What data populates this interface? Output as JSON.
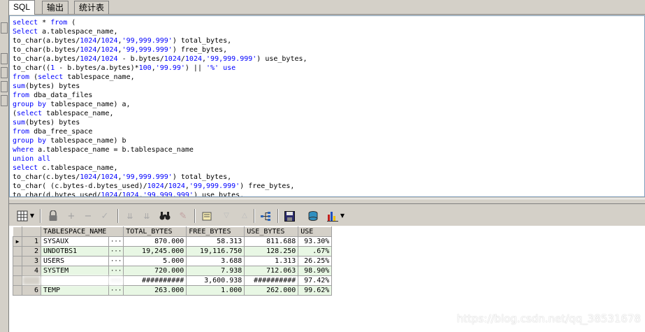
{
  "tabs": [
    {
      "label": "SQL",
      "active": true
    },
    {
      "label": "输出",
      "active": false
    },
    {
      "label": "统计表",
      "active": false
    }
  ],
  "editor": {
    "lines": [
      [
        [
          "kw",
          "select"
        ],
        [
          "plain",
          " * "
        ],
        [
          "kw",
          "from"
        ],
        [
          "plain",
          " ("
        ]
      ],
      [
        [
          "kw",
          "Select"
        ],
        [
          "plain",
          " a.tablespace_name,"
        ]
      ],
      [
        [
          "plain",
          "to_char(a.bytes/"
        ],
        [
          "num",
          "1024"
        ],
        [
          "plain",
          "/"
        ],
        [
          "num",
          "1024"
        ],
        [
          "plain",
          ","
        ],
        [
          "str",
          "'99,999.999'"
        ],
        [
          "plain",
          ") total_bytes,"
        ]
      ],
      [
        [
          "plain",
          "to_char(b.bytes/"
        ],
        [
          "num",
          "1024"
        ],
        [
          "plain",
          "/"
        ],
        [
          "num",
          "1024"
        ],
        [
          "plain",
          ","
        ],
        [
          "str",
          "'99,999.999'"
        ],
        [
          "plain",
          ") free_bytes,"
        ]
      ],
      [
        [
          "plain",
          "to_char(a.bytes/"
        ],
        [
          "num",
          "1024"
        ],
        [
          "plain",
          "/"
        ],
        [
          "num",
          "1024"
        ],
        [
          "plain",
          " - b.bytes/"
        ],
        [
          "num",
          "1024"
        ],
        [
          "plain",
          "/"
        ],
        [
          "num",
          "1024"
        ],
        [
          "plain",
          ","
        ],
        [
          "str",
          "'99,999.999'"
        ],
        [
          "plain",
          ") use_bytes,"
        ]
      ],
      [
        [
          "plain",
          "to_char(("
        ],
        [
          "num",
          "1"
        ],
        [
          "plain",
          " - b.bytes/a.bytes)*"
        ],
        [
          "num",
          "100"
        ],
        [
          "plain",
          ","
        ],
        [
          "str",
          "'99.99'"
        ],
        [
          "plain",
          ") || "
        ],
        [
          "str",
          "'%'"
        ],
        [
          "plain",
          " "
        ],
        [
          "kw",
          "use"
        ]
      ],
      [
        [
          "kw",
          "from"
        ],
        [
          "plain",
          " ("
        ],
        [
          "kw",
          "select"
        ],
        [
          "plain",
          " tablespace_name,"
        ]
      ],
      [
        [
          "kw",
          "sum"
        ],
        [
          "plain",
          "(bytes) bytes"
        ]
      ],
      [
        [
          "kw",
          "from"
        ],
        [
          "plain",
          " dba_data_files"
        ]
      ],
      [
        [
          "kw",
          "group by"
        ],
        [
          "plain",
          " tablespace_name) a,"
        ]
      ],
      [
        [
          "plain",
          "("
        ],
        [
          "kw",
          "select"
        ],
        [
          "plain",
          " tablespace_name,"
        ]
      ],
      [
        [
          "kw",
          "sum"
        ],
        [
          "plain",
          "(bytes) bytes"
        ]
      ],
      [
        [
          "kw",
          "from"
        ],
        [
          "plain",
          " dba_free_space"
        ]
      ],
      [
        [
          "kw",
          "group by"
        ],
        [
          "plain",
          " tablespace_name) b"
        ]
      ],
      [
        [
          "kw",
          "where"
        ],
        [
          "plain",
          " a.tablespace_name = b.tablespace_name"
        ]
      ],
      [
        [
          "kw",
          "union all"
        ]
      ],
      [
        [
          "kw",
          "select"
        ],
        [
          "plain",
          " c.tablespace_name,"
        ]
      ],
      [
        [
          "plain",
          "to_char(c.bytes/"
        ],
        [
          "num",
          "1024"
        ],
        [
          "plain",
          "/"
        ],
        [
          "num",
          "1024"
        ],
        [
          "plain",
          ","
        ],
        [
          "str",
          "'99,999.999'"
        ],
        [
          "plain",
          ") total_bytes,"
        ]
      ],
      [
        [
          "plain",
          "to_char( (c.bytes-d.bytes_used)/"
        ],
        [
          "num",
          "1024"
        ],
        [
          "plain",
          "/"
        ],
        [
          "num",
          "1024"
        ],
        [
          "plain",
          ","
        ],
        [
          "str",
          "'99,999.999'"
        ],
        [
          "plain",
          ") free_bytes,"
        ]
      ],
      [
        [
          "plain",
          "to_char(d.bytes_used/"
        ],
        [
          "num",
          "1024"
        ],
        [
          "plain",
          "/"
        ],
        [
          "num",
          "1024"
        ],
        [
          "plain",
          ","
        ],
        [
          "str",
          "'99,999.999'"
        ],
        [
          "plain",
          ") use_bytes,"
        ]
      ]
    ]
  },
  "grid": {
    "columns": [
      "TABLESPACE_NAME",
      "TOTAL_BYTES",
      "FREE_BYTES",
      "USE_BYTES",
      "USE"
    ],
    "rows": [
      {
        "num": "1",
        "name": "SYSAUX",
        "total": "870.000",
        "free": "58.313",
        "use_bytes": "811.688",
        "use": "93.30%",
        "current": true
      },
      {
        "num": "2",
        "name": "UNDOTBS1",
        "total": "19,245.000",
        "free": "19,116.750",
        "use_bytes": "128.250",
        "use": ".67%"
      },
      {
        "num": "3",
        "name": "USERS",
        "total": "5.000",
        "free": "3.688",
        "use_bytes": "1.313",
        "use": "26.25%"
      },
      {
        "num": "4",
        "name": "SYSTEM",
        "total": "720.000",
        "free": "7.938",
        "use_bytes": "712.063",
        "use": "98.90%"
      },
      {
        "num": "",
        "name": "",
        "total": "##########",
        "free": "3,600.938",
        "use_bytes": "##########",
        "use": "97.42%",
        "blurred": true
      },
      {
        "num": "6",
        "name": "TEMP",
        "total": "263.000",
        "free": "1.000",
        "use_bytes": "262.000",
        "use": "99.62%"
      }
    ],
    "cell_button_glyph": "···"
  },
  "watermark": "https://blog.csdn.net/qq_38531678",
  "colors": {
    "keyword": "#0000ff",
    "even_row": "#e8f7e4",
    "editor_bg": "#ffffff",
    "chrome": "#d4d0c8"
  }
}
